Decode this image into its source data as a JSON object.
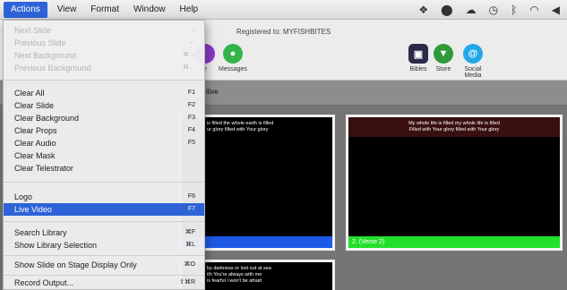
{
  "menubar": {
    "items": [
      "Actions",
      "View",
      "Format",
      "Window",
      "Help"
    ],
    "tray_icons": [
      "dropbox-icon",
      "location-icon",
      "cloud-icon",
      "clock-icon",
      "bluetooth-icon",
      "wifi-icon",
      "volume-icon"
    ]
  },
  "toolbar": {
    "registered": "Registered to: MYFISHBITES",
    "messages_label": "Messages",
    "media_label": "e",
    "bibles_label": "Bibles",
    "store_label": "Store",
    "social_label": "Social Media"
  },
  "presentation": {
    "title_fragment": "ilive"
  },
  "slides": [
    {
      "text": "is filled the whole earth is filled\nur glory filled with Your glory",
      "label": ""
    },
    {
      "text": "My whole life is filled my whole life is filled\nFilled with Your glory filled with Your glory",
      "label": "2. (Verse 2)"
    },
    {
      "text": "by darkness or lost out at sea\nith You're always with me\nis fearful I won't be afraid",
      "label": ""
    }
  ],
  "dropdown": {
    "items": [
      {
        "label": "Next Slide",
        "shortcut": "→",
        "disabled": true
      },
      {
        "label": "Previous Slide",
        "shortcut": "←",
        "disabled": true
      },
      {
        "label": "Next Background",
        "shortcut": "⌘→",
        "disabled": true
      },
      {
        "label": "Previous Background",
        "shortcut": "⌘←",
        "disabled": true
      },
      {
        "label": "Clear All",
        "shortcut": "F1"
      },
      {
        "label": "Clear Slide",
        "shortcut": "F2"
      },
      {
        "label": "Clear Background",
        "shortcut": "F3"
      },
      {
        "label": "Clear Props",
        "shortcut": "F4"
      },
      {
        "label": "Clear Audio",
        "shortcut": "F5"
      },
      {
        "label": "Clear Mask",
        "shortcut": ""
      },
      {
        "label": "Clear Telestrator",
        "shortcut": ""
      },
      {
        "label": "Logo",
        "shortcut": "F6"
      },
      {
        "label": "Live Video",
        "shortcut": "F7",
        "highlighted": true
      },
      {
        "label": "Search Library",
        "shortcut": "⌘F"
      },
      {
        "label": "Show Library Selection",
        "shortcut": "⌘L"
      },
      {
        "label": "Show Slide on Stage Display Only",
        "shortcut": "⌘O"
      },
      {
        "label": "Record Output...",
        "shortcut": "⇧⌘R"
      }
    ]
  },
  "colors": {
    "highlight": "#2d63d6",
    "slide_blue": "#1e58e6",
    "slide_green": "#22e02a",
    "slide_header": "#3a0f0f"
  }
}
